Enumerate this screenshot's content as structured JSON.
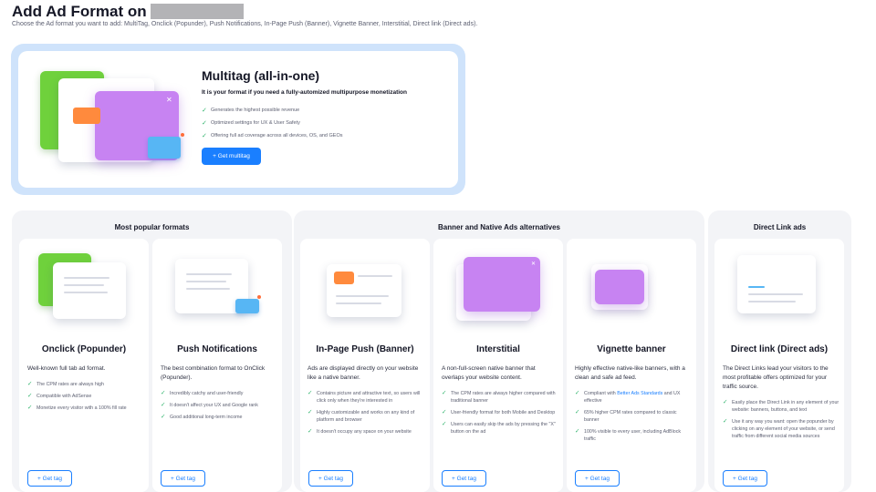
{
  "header": {
    "title": "Add Ad Format on",
    "subtitle": "Choose the Ad format you want to add: MultiTag, Onclick (Popunder), Push Notifications, In-Page Push (Banner), Vignette Banner, Interstitial, Direct link (Direct ads)."
  },
  "hero": {
    "title": "Multitag (all-in-one)",
    "description": "It is your format if you need a fully-automized multipurpose monetization",
    "features": [
      "Generates the highest possible revenue",
      "Optimized settings for UX & User Safety",
      "Offering full ad coverage across all devices, OS, and GEOs"
    ],
    "button_label": "+ Get multitag"
  },
  "groups": [
    {
      "title": "Most popular formats"
    },
    {
      "title": "Banner and Native Ads alternatives"
    },
    {
      "title": "Direct Link ads"
    }
  ],
  "cards": [
    {
      "title": "Onclick (Popunder)",
      "description": "Well-known full tab ad format.",
      "features": [
        "The CPM rates are always high",
        "Compatible with AdSense",
        "Monetize every visitor with a 100% fill rate"
      ],
      "button_label": "+ Get tag"
    },
    {
      "title": "Push Notifications",
      "description": "The best combination format to OnClick (Popunder).",
      "features": [
        "Incredibly catchy and user-friendly",
        "It doesn't affect your UX and Google rank",
        "Good additional long-term income"
      ],
      "button_label": "+ Get tag"
    },
    {
      "title": "In-Page Push (Banner)",
      "description": "Ads are displayed directly on your website like a native banner.",
      "features": [
        "Contains picture and attractive text, so users will click only when they're interested in",
        "Highly customizable and works on any kind of platform and browser",
        "It doesn't occupy any space on your website"
      ],
      "button_label": "+ Get tag"
    },
    {
      "title": "Interstitial",
      "description": "A non-full-screen native banner that overlaps your website content.",
      "features": [
        "The CPM rates are always higher compared with traditional banner",
        "User-friendly format for both Mobile and Desktop",
        "Users can easily skip the ads by pressing the \"X\" button on the ad"
      ],
      "button_label": "+ Get tag"
    },
    {
      "title": "Vignette banner",
      "description": "Highly effective native-like banners, with a clean and safe ad feed.",
      "features": [
        "65% higher CPM rates compared to classic banner",
        "100% visible to every user, including AdBlock traffic"
      ],
      "feature_compliant": {
        "prefix": "Compliant with ",
        "link": "Better Ads Standards",
        "suffix": " and UX effective"
      },
      "button_label": "+ Get tag"
    },
    {
      "title": "Direct link (Direct ads)",
      "description": "The Direct Links lead your visitors to the most profitable offers optimized for your traffic source.",
      "features": [
        "Easily place the Direct Link in any element of your website: banners, buttons, and text",
        "Use it any way you want: open the popunder by clicking on any element of your website, or send traffic from different social media sources"
      ],
      "button_label": "+ Get tag"
    }
  ],
  "icons": {
    "check": "check-icon",
    "close": "close-icon"
  },
  "colors": {
    "accent": "#1a7fff",
    "check": "#2fb36b",
    "hero_frame": "#cfe3fb",
    "panel": "#f3f4f7"
  }
}
